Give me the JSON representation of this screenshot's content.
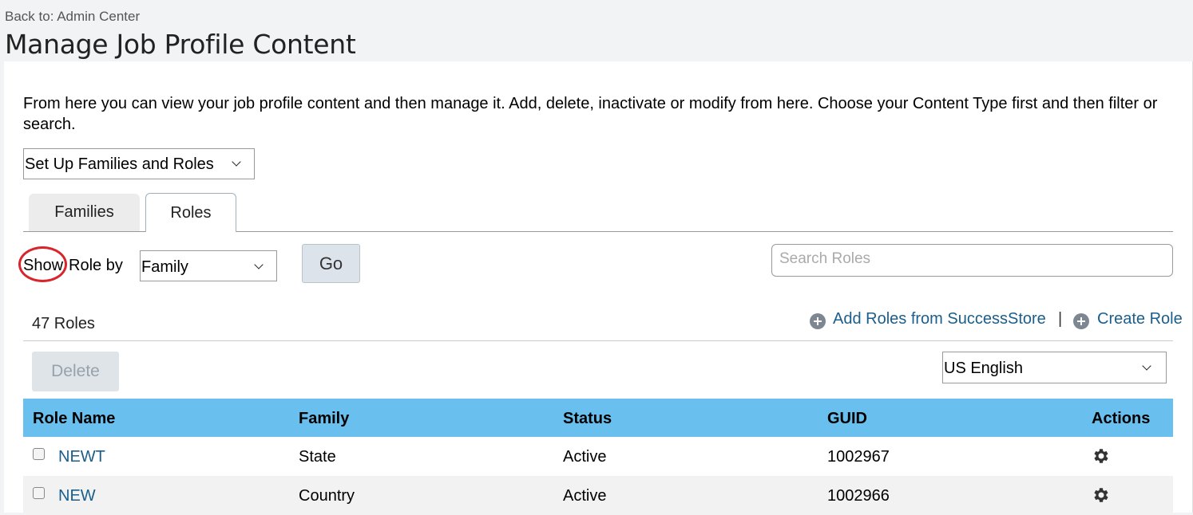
{
  "header": {
    "back_link": "Back to: Admin Center",
    "title": "Manage Job Profile Content"
  },
  "intro_text": "From here you can view your job profile content and then manage it. Add, delete, inactivate or modify from here. Choose your Content Type first and then filter or search.",
  "content_type_select": {
    "value": "Set Up Families and Roles"
  },
  "tabs": [
    {
      "label": "Families",
      "selected": false
    },
    {
      "label": "Roles",
      "selected": true
    }
  ],
  "filter": {
    "show_label": "Show",
    "role_by_label": "Role by",
    "role_by_value": "Family",
    "go_label": "Go",
    "search_placeholder": "Search Roles"
  },
  "annotation_color": "#d8242b",
  "roles_count": "47 Roles",
  "actions": {
    "add_from_store": "Add Roles from SuccessStore",
    "separator": "|",
    "create": "Create Role"
  },
  "delete_label": "Delete",
  "language_select": {
    "value": "US English"
  },
  "table": {
    "header_color": "#69c0ef",
    "columns": [
      "Role Name",
      "Family",
      "Status",
      "GUID",
      "Actions"
    ],
    "rows": [
      {
        "role_name": "NEWT",
        "family": "State",
        "status": "Active",
        "guid": "1002967",
        "action_icon": "gear-icon"
      },
      {
        "role_name": "NEW",
        "family": "Country",
        "status": "Active",
        "guid": "1002966",
        "action_icon": "gear-icon"
      }
    ]
  },
  "link_color": "#1a5e8c"
}
